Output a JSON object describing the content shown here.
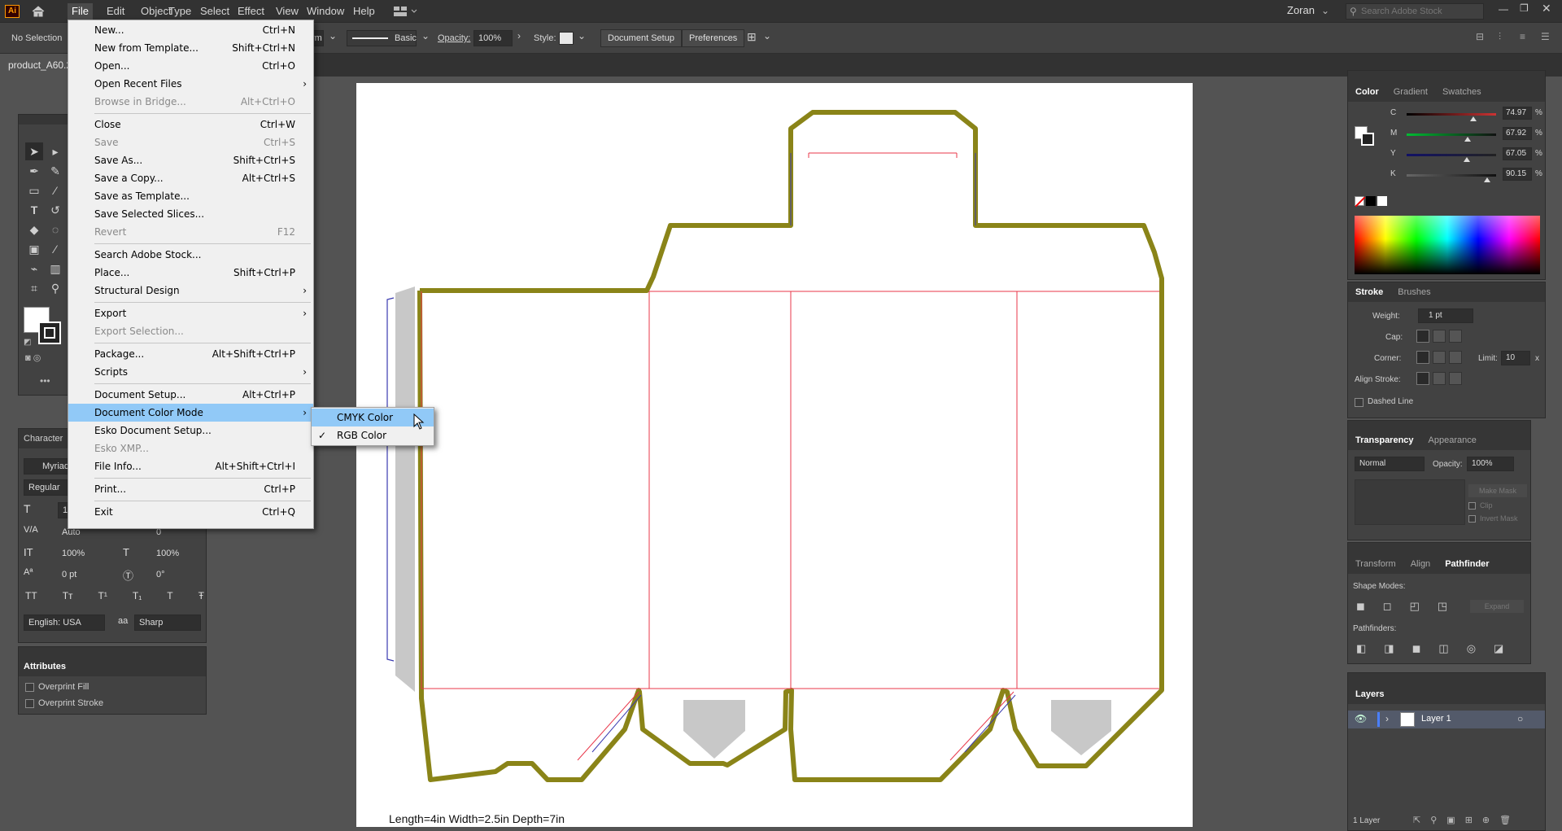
{
  "app": {
    "logo": "Ai"
  },
  "menubar": {
    "items": [
      "File",
      "Edit",
      "Object",
      "Type",
      "Select",
      "Effect",
      "View",
      "Window",
      "Help"
    ],
    "user": "Zoran",
    "search_placeholder": "Search Adobe Stock"
  },
  "control": {
    "selection": "No Selection",
    "stroke_profile": "Basic",
    "opacity_label": "Opacity:",
    "opacity_value": "100%",
    "style_label": "Style:",
    "doc_setup": "Document Setup",
    "preferences": "Preferences",
    "partial_label": "rm"
  },
  "document": {
    "tab": "product_A60.2"
  },
  "file_menu": [
    {
      "label": "New...",
      "shortcut": "Ctrl+N"
    },
    {
      "label": "New from Template...",
      "shortcut": "Shift+Ctrl+N"
    },
    {
      "label": "Open...",
      "shortcut": "Ctrl+O"
    },
    {
      "label": "Open Recent Files",
      "shortcut": "",
      "submenu": true
    },
    {
      "label": "Browse in Bridge...",
      "shortcut": "Alt+Ctrl+O",
      "disabled": true
    },
    {
      "label": "Close",
      "shortcut": "Ctrl+W"
    },
    {
      "label": "Save",
      "shortcut": "Ctrl+S",
      "disabled": true
    },
    {
      "label": "Save As...",
      "shortcut": "Shift+Ctrl+S"
    },
    {
      "label": "Save a Copy...",
      "shortcut": "Alt+Ctrl+S"
    },
    {
      "label": "Save as Template...",
      "shortcut": ""
    },
    {
      "label": "Save Selected Slices...",
      "shortcut": ""
    },
    {
      "label": "Revert",
      "shortcut": "F12",
      "disabled": true
    },
    {
      "label": "Search Adobe Stock...",
      "shortcut": ""
    },
    {
      "label": "Place...",
      "shortcut": "Shift+Ctrl+P"
    },
    {
      "label": "Structural Design",
      "shortcut": "",
      "submenu": true
    },
    {
      "label": "Export",
      "shortcut": "",
      "submenu": true
    },
    {
      "label": "Export Selection...",
      "shortcut": "",
      "disabled": true
    },
    {
      "label": "Package...",
      "shortcut": "Alt+Shift+Ctrl+P"
    },
    {
      "label": "Scripts",
      "shortcut": "",
      "submenu": true
    },
    {
      "label": "Document Setup...",
      "shortcut": "Alt+Ctrl+P"
    },
    {
      "label": "Document Color Mode",
      "shortcut": "",
      "submenu": true,
      "highlighted": true
    },
    {
      "label": "Esko Document Setup...",
      "shortcut": ""
    },
    {
      "label": "Esko XMP...",
      "shortcut": "",
      "disabled": true
    },
    {
      "label": "File Info...",
      "shortcut": "Alt+Shift+Ctrl+I"
    },
    {
      "label": "Print...",
      "shortcut": "Ctrl+P"
    },
    {
      "label": "Exit",
      "shortcut": "Ctrl+Q"
    }
  ],
  "color_mode_submenu": [
    {
      "label": "CMYK Color",
      "highlighted": true,
      "checked": false
    },
    {
      "label": "RGB Color",
      "checked": true
    }
  ],
  "color_panel": {
    "tabs": [
      "Color",
      "Gradient",
      "Swatches"
    ],
    "channels": [
      {
        "name": "C",
        "value": "74.97",
        "pct": "%",
        "level": 0.7497
      },
      {
        "name": "M",
        "value": "67.92",
        "pct": "%",
        "level": 0.6792
      },
      {
        "name": "Y",
        "value": "67.05",
        "pct": "%",
        "level": 0.6705
      },
      {
        "name": "K",
        "value": "90.15",
        "pct": "%",
        "level": 0.9015
      }
    ]
  },
  "stroke_panel": {
    "tabs": [
      "Stroke",
      "Brushes"
    ],
    "weight_label": "Weight:",
    "weight_value": "1 pt",
    "cap_label": "Cap:",
    "corner_label": "Corner:",
    "limit_label": "Limit:",
    "limit_value": "10",
    "limit_x": "x",
    "align_label": "Align Stroke:",
    "dashed_label": "Dashed Line"
  },
  "transparency_panel": {
    "tabs": [
      "Transparency",
      "Appearance"
    ],
    "blend": "Normal",
    "opacity_label": "Opacity:",
    "opacity_value": "100%",
    "make_mask": "Make Mask",
    "clip": "Clip",
    "invert_mask": "Invert Mask"
  },
  "pathfinder_panel": {
    "tabs": [
      "Transform",
      "Align",
      "Pathfinder"
    ],
    "shape_modes": "Shape Modes:",
    "expand": "Expand",
    "pathfinders": "Pathfinders:"
  },
  "layers_panel": {
    "title": "Layers",
    "layer_name": "Layer 1",
    "footer": "1 Layer"
  },
  "character_panel": {
    "title": "Character",
    "font": "Myriad",
    "style": "Regular",
    "size": "12",
    "leading": "Auto",
    "tracking": "0",
    "vscale": "100%",
    "hscale": "100%",
    "baseline": "0 pt",
    "rotation": "0°",
    "language": "English: USA",
    "aa_label": "aa",
    "antialias": "Sharp",
    "tt_buttons": [
      "TT",
      "Tт",
      "T¹",
      "T₁",
      "T",
      "Ŧ"
    ]
  },
  "attributes_panel": {
    "title": "Attributes",
    "overprint_fill": "Overprint Fill",
    "overprint_stroke": "Overprint Stroke"
  },
  "artboard": {
    "dimensions_text": "Length=4in Width=2.5in Depth=7in"
  },
  "colors": {
    "dieline_stroke": "#8a8418",
    "crease": "#e8374a",
    "blue_line": "#3a3ab0",
    "menu_highlight": "#91c9f7"
  }
}
